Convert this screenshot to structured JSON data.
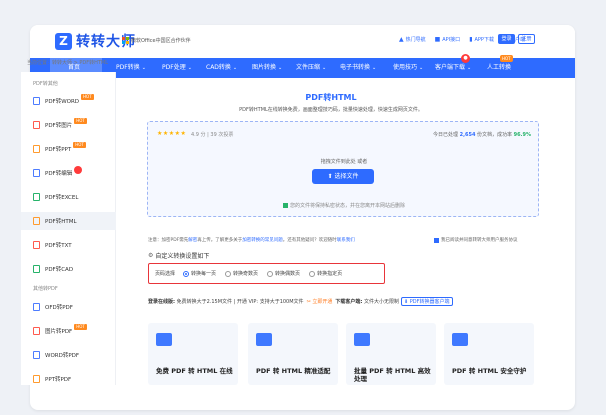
{
  "header": {
    "logo_text": "转转大师",
    "partner": "微软Office中国区合作伙伴",
    "links": [
      {
        "icon": "flame-icon",
        "label": "热门导航"
      },
      {
        "icon": "api-icon",
        "label": "API接口"
      },
      {
        "icon": "download-icon",
        "label": "APP下载"
      },
      {
        "icon": "user-icon",
        "label": "客户端"
      }
    ],
    "login": "登录",
    "register": "注册"
  },
  "nav": {
    "items": [
      {
        "label": "首页"
      },
      {
        "label": "PDF转换"
      },
      {
        "label": "PDF处理"
      },
      {
        "label": "CAD转换"
      },
      {
        "label": "图片转换"
      },
      {
        "label": "文件压缩"
      },
      {
        "label": "电子书转换"
      },
      {
        "label": "使用技巧"
      },
      {
        "label": "客户端下载"
      },
      {
        "label": "人工转换"
      }
    ],
    "hot_badge": "HOT"
  },
  "breadcrumb": "当前位置：转转大师 > PDF转HTML",
  "sidebar": {
    "categories": [
      "PDF转其他",
      "其他转PDF"
    ],
    "items": [
      {
        "label": "PDF转WORD"
      },
      {
        "label": "PDF转图片"
      },
      {
        "label": "PDF转PPT"
      },
      {
        "label": "PDF转编辑"
      },
      {
        "label": "PDF转EXCEL"
      },
      {
        "label": "PDF转HTML"
      },
      {
        "label": "PDF转TXT"
      },
      {
        "label": "PDF转CAD"
      },
      {
        "label": "OFD转PDF"
      },
      {
        "label": "图片转PDF"
      },
      {
        "label": "WORD转PDF"
      },
      {
        "label": "PPT转PDF"
      }
    ]
  },
  "main": {
    "title": "PDF转HTML",
    "description": "PDF转HTML在线转换免费，画面整理技巧码，批量快速处理，快速生成网页文件。",
    "rating_stars": "★★★★★",
    "rating_text": "4.9 分 | 39 次投票",
    "stat_prefix": "今日已处理",
    "stat_count": "2,654",
    "stat_mid": "份文档，成功率",
    "stat_rate": "96.9%",
    "drag_tip": "拖拽文件到此处 或者",
    "select_button": "选择文件",
    "privacy": "您的文件将保持私密状态，并在您离开本网站后删除"
  },
  "notice": {
    "prefix": "注意：加密PDF需先",
    "link1": "解密",
    "middle": "再上传。了解更多关于",
    "link2": "加密转换的常见问题",
    "suffix": "。还有其他疑问？欢迎随时",
    "link3": "联系我们"
  },
  "allow_text": "我已阅读并同意转转大师用户服务协议",
  "custom_settings_title": "自定义转换设置如下",
  "options": {
    "label": "页码选择",
    "choices": [
      {
        "label": "转换每一页",
        "checked": true
      },
      {
        "label": "转换奇数页",
        "checked": false
      },
      {
        "label": "转换偶数页",
        "checked": false
      },
      {
        "label": "转换指定页",
        "checked": false
      }
    ]
  },
  "limit_bar": {
    "label": "登录在线版:",
    "text": "免费转换大于2.15M文件 | 开通 VIP: 支持大于100M文件",
    "upgrade": "立即开通",
    "client_label": "下载客户端:",
    "client_text": "文件大小无限制",
    "client_button": "PDF转换器客户端"
  },
  "cards": [
    {
      "title": "免费 PDF 转 HTML 在线"
    },
    {
      "title": "PDF 转 HTML 精准适配"
    },
    {
      "title": "批量 PDF 转 HTML 高效处理"
    },
    {
      "title": "PDF 转 HTML 安全守护"
    }
  ],
  "colors": {
    "brand": "#2e6bff",
    "hot": "#ff8a1f",
    "highlight_border": "#e8353a",
    "success": "#27b36a"
  }
}
